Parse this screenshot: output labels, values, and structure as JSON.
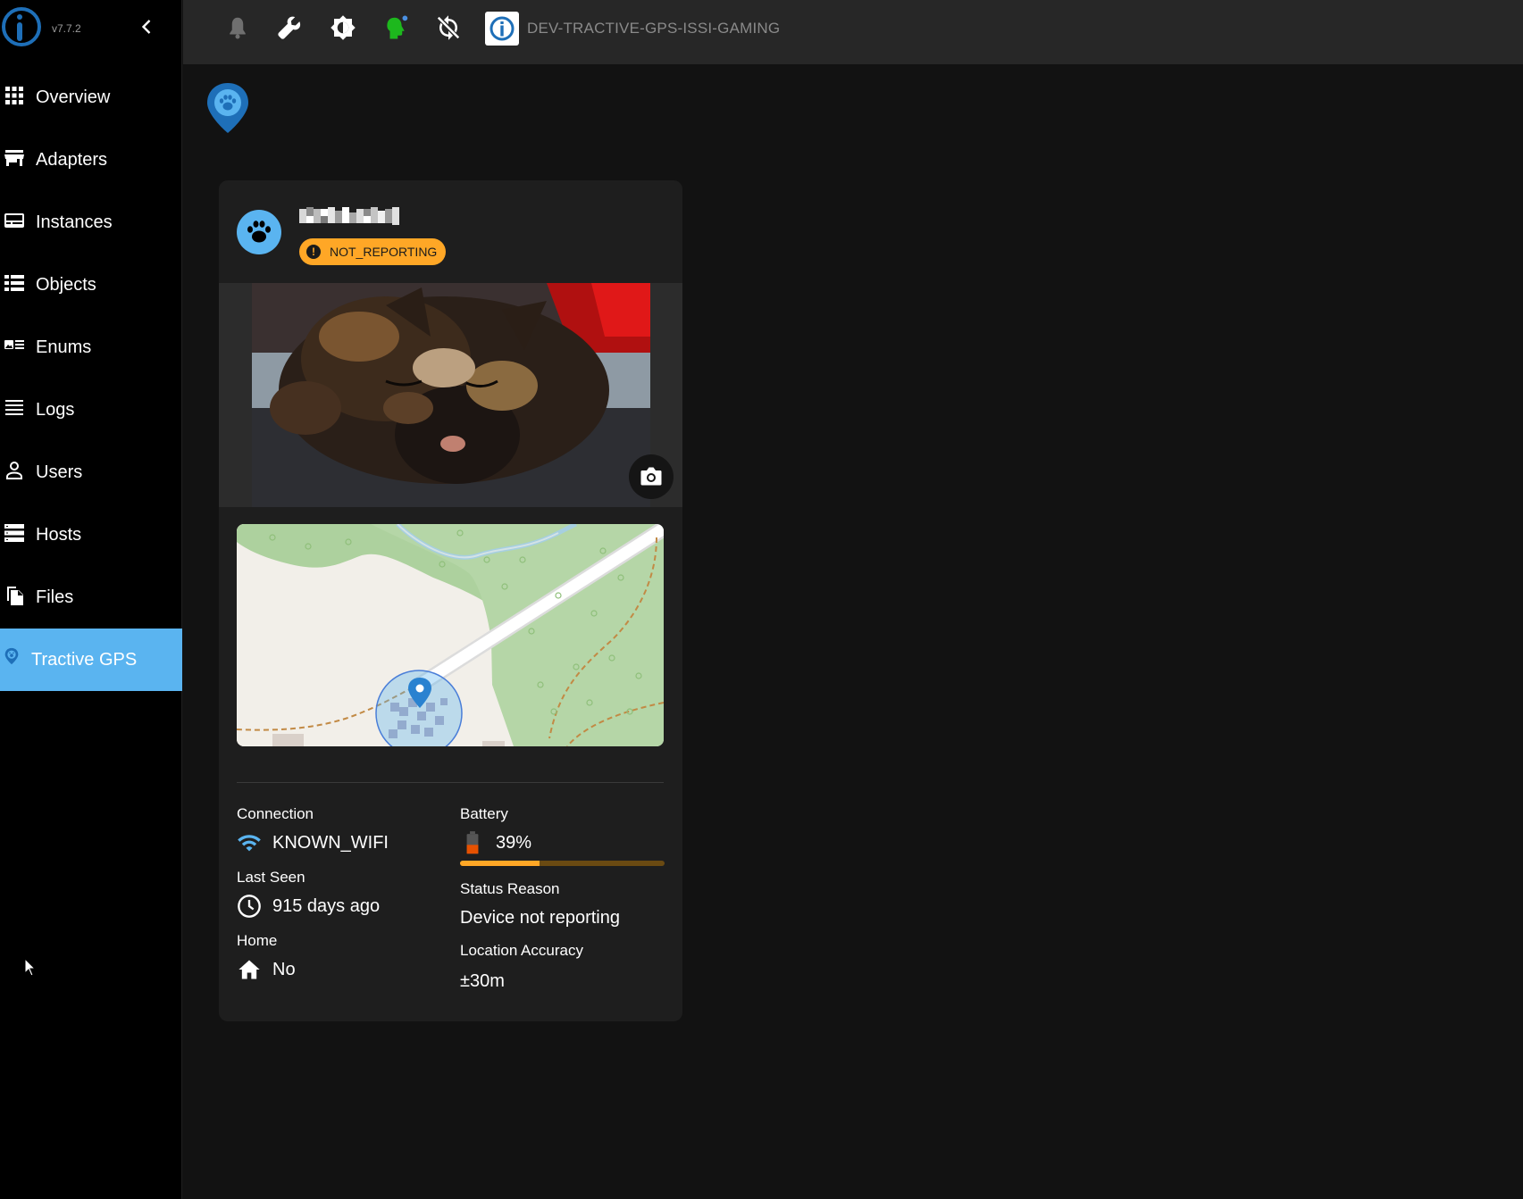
{
  "app": {
    "version": "v7.7.2"
  },
  "topbar": {
    "icons": [
      "bell-icon",
      "wrench-icon",
      "brightness-icon",
      "expert-mode-icon",
      "sync-off-icon"
    ],
    "host_name": "DEV-TRACTIVE-GPS-ISSI-GAMING"
  },
  "sidebar": {
    "items": [
      {
        "label": "Overview",
        "icon": "grid-icon"
      },
      {
        "label": "Adapters",
        "icon": "store-icon"
      },
      {
        "label": "Instances",
        "icon": "instances-icon"
      },
      {
        "label": "Objects",
        "icon": "list-icon"
      },
      {
        "label": "Enums",
        "icon": "enums-icon"
      },
      {
        "label": "Logs",
        "icon": "logs-icon"
      },
      {
        "label": "Users",
        "icon": "user-icon"
      },
      {
        "label": "Hosts",
        "icon": "hosts-icon"
      },
      {
        "label": "Files",
        "icon": "files-icon"
      },
      {
        "label": "Tractive GPS",
        "icon": "tractive-icon",
        "active": true
      }
    ]
  },
  "device": {
    "status": "NOT_REPORTING",
    "details": {
      "connection_label": "Connection",
      "connection_value": "KNOWN_WIFI",
      "last_seen_label": "Last Seen",
      "last_seen_value": "915 days ago",
      "home_label": "Home",
      "home_value": "No",
      "battery_label": "Battery",
      "battery_value": "39%",
      "battery_level": 0.39,
      "status_reason_label": "Status Reason",
      "status_reason_value": "Device not reporting",
      "accuracy_label": "Location Accuracy",
      "accuracy_value": "±30m"
    }
  },
  "colors": {
    "accent": "#5ab4f0",
    "warning": "#ffa726",
    "brand": "#1e6fb8",
    "sidebar_bg": "#000000",
    "topbar_bg": "#272727",
    "card_bg": "#1e1e1e"
  }
}
